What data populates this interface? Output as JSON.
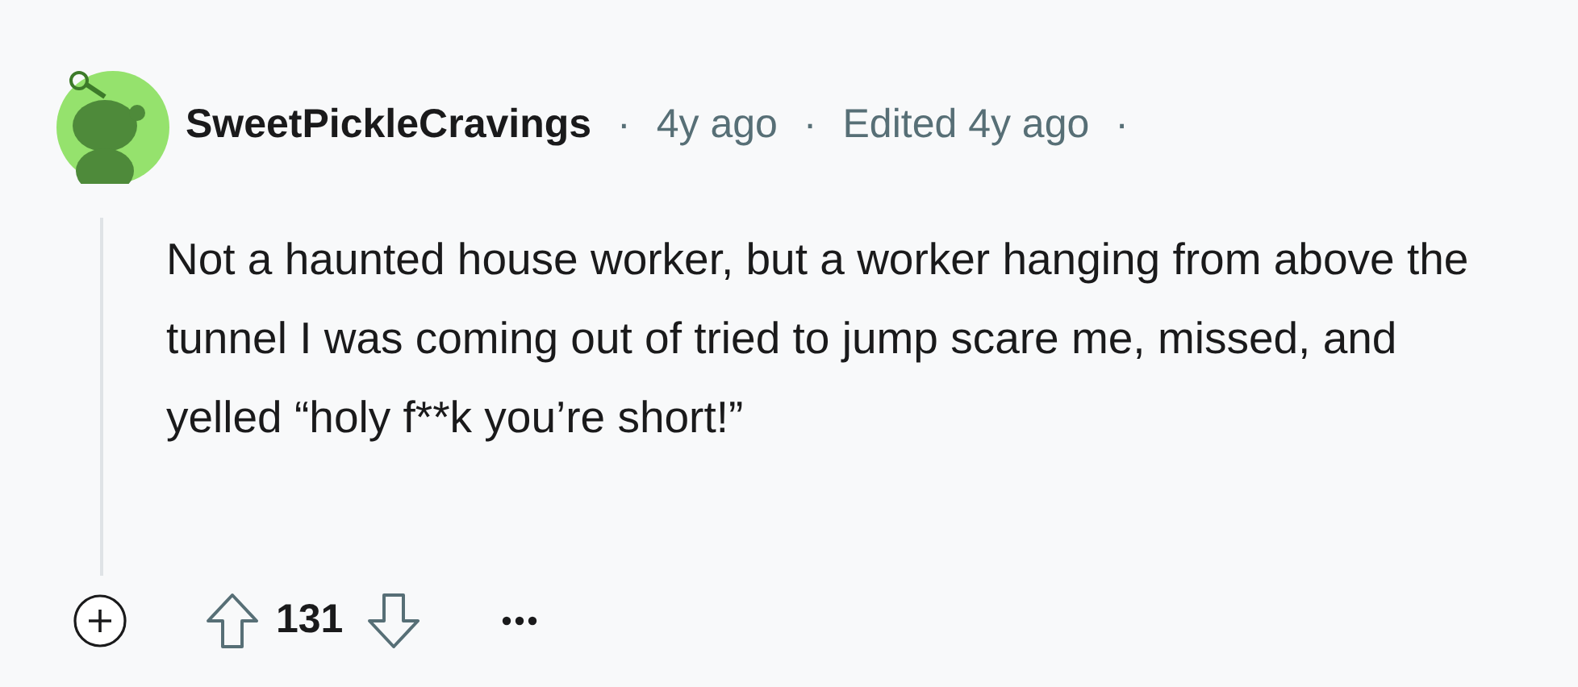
{
  "comment": {
    "author": "SweetPickleCravings",
    "meta": [
      "·",
      "4y ago",
      "·",
      "Edited 4y ago",
      "·"
    ],
    "body": "Not a haunted house worker, but a worker hanging from above the tunnel I was coming out of tried to jump scare me, missed, and yelled “holy f**k you’re short!”",
    "score": "131"
  }
}
